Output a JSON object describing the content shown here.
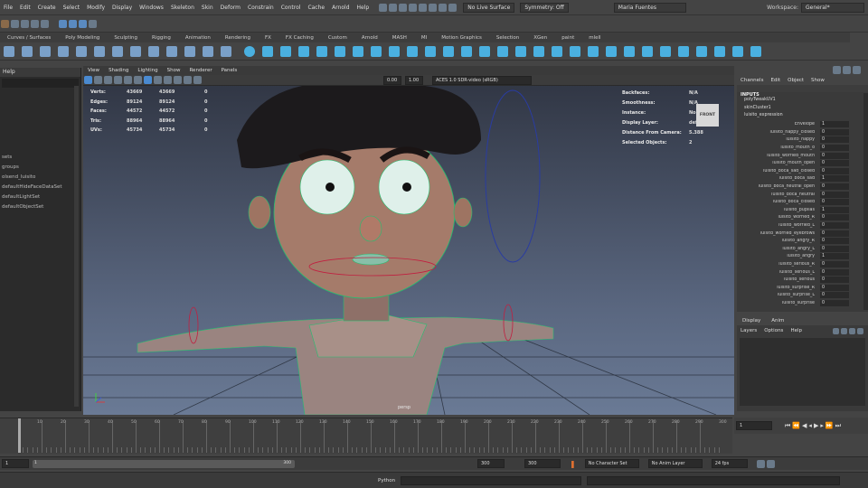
{
  "menubar": {
    "items": [
      "File",
      "Edit",
      "Create",
      "Select",
      "Modify",
      "Display",
      "Windows",
      "Skeleton",
      "Skin",
      "Deform",
      "Constrain",
      "Control",
      "Cache",
      "Arnold",
      "Help"
    ],
    "live_surface": "No Live Surface",
    "symmetry": "Symmetry: Off",
    "user": "Maria Fuentes",
    "workspace_label": "Workspace:",
    "workspace_value": "General*"
  },
  "shelf": {
    "tabs": [
      "Curves / Surfaces",
      "Poly Modeling",
      "Sculpting",
      "Rigging",
      "Animation",
      "Rendering",
      "FX",
      "FX Caching",
      "Custom",
      "Arnold",
      "MASH",
      "MI",
      "Motion Graphics",
      "Selection",
      "XGen",
      "paint",
      "mlell"
    ]
  },
  "outliner": {
    "help": "Help",
    "items": [
      "sets",
      "groups",
      "olsend_luisito",
      "defaultHideFaceDataSet",
      "defaultLightSet",
      "defaultObjectSet"
    ]
  },
  "viewport": {
    "menu": [
      "View",
      "Shading",
      "Lighting",
      "Show",
      "Renderer",
      "Panels"
    ],
    "exposure": "0.00",
    "gamma": "1.00",
    "colorspace": "ACES 1.0 SDR-video (sRGB)",
    "camera_label": "persp",
    "cube_label": "FRONT",
    "hud_left": [
      {
        "label": "Verts:",
        "a": "43669",
        "b": "43669",
        "c": "0"
      },
      {
        "label": "Edges:",
        "a": "89124",
        "b": "89124",
        "c": "0"
      },
      {
        "label": "Faces:",
        "a": "44572",
        "b": "44572",
        "c": "0"
      },
      {
        "label": "Tris:",
        "a": "88964",
        "b": "88964",
        "c": "0"
      },
      {
        "label": "UVs:",
        "a": "45734",
        "b": "45734",
        "c": "0"
      }
    ],
    "hud_right": [
      {
        "label": "Backfaces:",
        "value": "N/A"
      },
      {
        "label": "Smoothness:",
        "value": "N/A"
      },
      {
        "label": "Instance:",
        "value": "No"
      },
      {
        "label": "Display Layer:",
        "value": "default"
      },
      {
        "label": "Distance From Camera:",
        "value": "5.388"
      },
      {
        "label": "Selected Objects:",
        "value": "2"
      }
    ]
  },
  "channelbox": {
    "tabs": [
      "Channels",
      "Edit",
      "Object",
      "Show"
    ],
    "inputs_label": "INPUTS",
    "inputs": [
      "polyTweakUV1",
      "skinCluster1",
      "luisito_expression"
    ],
    "attributes": [
      {
        "name": "Envelope",
        "value": "1"
      },
      {
        "name": "luisito_happy_closed",
        "value": "0"
      },
      {
        "name": "luisito_happy",
        "value": "0"
      },
      {
        "name": "luisito_mouth_o",
        "value": "0"
      },
      {
        "name": "luisito_worried_mouth",
        "value": "0"
      },
      {
        "name": "luisito_mouth_open",
        "value": "0"
      },
      {
        "name": "luisito_boca_sad_closed",
        "value": "0"
      },
      {
        "name": "luisito_boca_sad",
        "value": "1"
      },
      {
        "name": "luisito_boca_neutral_open",
        "value": "0"
      },
      {
        "name": "luisito_boca_neutral",
        "value": "0"
      },
      {
        "name": "luisito_boca_closed",
        "value": "0"
      },
      {
        "name": "luisito_pupilas",
        "value": "1"
      },
      {
        "name": "luisito_worried_R",
        "value": "0"
      },
      {
        "name": "luisito_worried_L",
        "value": "0"
      },
      {
        "name": "luisito_worried_eyebrows",
        "value": "0"
      },
      {
        "name": "luisito_angry_R",
        "value": "0"
      },
      {
        "name": "luisito_angry_L",
        "value": "0"
      },
      {
        "name": "luisito_angry",
        "value": "1"
      },
      {
        "name": "luisito_serious_R",
        "value": "0"
      },
      {
        "name": "luisito_serious_L",
        "value": "0"
      },
      {
        "name": "luisito_serious",
        "value": "0"
      },
      {
        "name": "luisito_surprise_R",
        "value": "0"
      },
      {
        "name": "luisito_surprise_L",
        "value": "0"
      },
      {
        "name": "luisito_surprise",
        "value": "0"
      }
    ]
  },
  "layers": {
    "tabs": [
      "Display",
      "Anim"
    ],
    "menu": [
      "Layers",
      "Options",
      "Help"
    ]
  },
  "timeline": {
    "ticks": [
      "10",
      "20",
      "30",
      "40",
      "50",
      "60",
      "70",
      "80",
      "90",
      "100",
      "110",
      "120",
      "130",
      "140",
      "150",
      "160",
      "170",
      "180",
      "190",
      "200",
      "210",
      "220",
      "230",
      "240",
      "250",
      "260",
      "270",
      "280",
      "290",
      "300"
    ],
    "current_frame": "1",
    "range_start": "1",
    "range_end": "300",
    "anim_start": "300",
    "anim_end": "300",
    "character_set": "No Character Set",
    "anim_layer": "No Anim Layer",
    "fps": "24 fps"
  },
  "cmdline": {
    "language": "Python",
    "mel": "MEL"
  }
}
